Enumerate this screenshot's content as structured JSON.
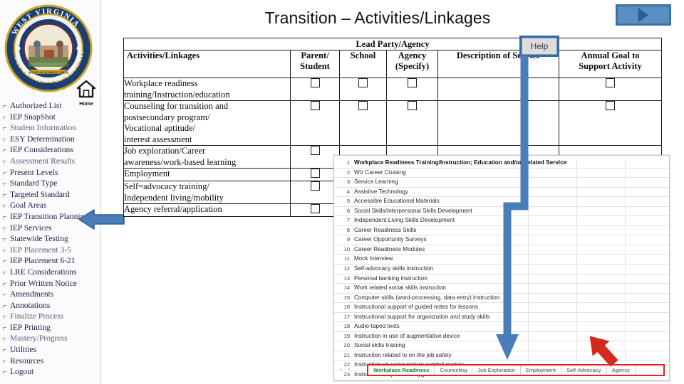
{
  "slide": {
    "title": "Transition – Activities/Linkages",
    "play_button_icon": "play-triangle-icon"
  },
  "sidebar": {
    "logo_alt": "West Virginia Department of Education",
    "seal_text": {
      "outer_top": "WEST VIRGINIA",
      "outer_bottom": "DEPARTMENT OF EDUCATION",
      "inner_top": "STATE OF WEST VIRGINIA",
      "inner_bottom": "MONTANI SEMPER LIBERI"
    },
    "home_label": "Home",
    "items": [
      {
        "label": "Authorized List"
      },
      {
        "label": "IEP SnapShot"
      },
      {
        "label": "Student Information"
      },
      {
        "label": "ESY Determination"
      },
      {
        "label": "IEP Considerations"
      },
      {
        "label": "Assessment Results"
      },
      {
        "label": "Present Levels"
      },
      {
        "label": "Standard Type"
      },
      {
        "label": "Targeted Standard"
      },
      {
        "label": "Goal Areas"
      },
      {
        "label": "IEP Transition Planning"
      },
      {
        "label": "IEP Services"
      },
      {
        "label": "Statewide Testing"
      },
      {
        "label": "IEP Placement 3-5"
      },
      {
        "label": "IEP Placement 6-21"
      },
      {
        "label": "LRE Considerations"
      },
      {
        "label": "Prior Written Notice"
      },
      {
        "label": "Amendments"
      },
      {
        "label": "Annotations"
      },
      {
        "label": "Finalize Process"
      },
      {
        "label": "IEP Printing"
      },
      {
        "label": "Mastery/Progress"
      },
      {
        "label": "Utilities"
      },
      {
        "label": "Resources"
      },
      {
        "label": "Logout"
      }
    ]
  },
  "form_table": {
    "group_header": "Lead Party/Agency",
    "columns": [
      "Activities/Linkages",
      "Parent/\nStudent",
      "School",
      "Agency\n(Specify)",
      "Description of Service",
      "Annual Goal to\nSupport Activity"
    ],
    "column_labels": {
      "activities": "Activities/Linkages",
      "parent_student_l1": "Parent/",
      "parent_student_l2": "Student",
      "school": "School",
      "agency_l1": "Agency",
      "agency_l2": "(Specify)",
      "description": "Description of Service",
      "goal_l1": "Annual Goal to",
      "goal_l2": "Support Activity"
    },
    "rows": [
      {
        "activity_lines": [
          "Workplace readiness",
          "training/Instruction/education"
        ],
        "parent_student": false,
        "school": false,
        "agency": false,
        "description": "",
        "annual_goal": false,
        "show_school": true,
        "show_agency": true,
        "show_goal": true
      },
      {
        "activity_lines": [
          "Counseling for transition and",
          "postsecondary program/",
          "Vocational aptitude/",
          "interest assessment"
        ],
        "parent_student": false,
        "school": false,
        "agency": false,
        "description": "",
        "annual_goal": false,
        "show_school": true,
        "show_agency": true,
        "show_goal": true
      },
      {
        "activity_lines": [
          "Job exploration/Career",
          "awareness/work-based learning"
        ],
        "parent_student": false,
        "school": false,
        "agency": false,
        "description": "",
        "annual_goal": false,
        "show_school": false,
        "show_agency": false,
        "show_goal": false
      },
      {
        "activity_lines": [
          "Employment"
        ],
        "parent_student": false,
        "school": false,
        "agency": false,
        "description": "",
        "annual_goal": false,
        "show_school": false,
        "show_agency": false,
        "show_goal": false
      },
      {
        "activity_lines": [
          "Self=advocacy training/",
          "Independent living/mobility"
        ],
        "parent_student": false,
        "school": false,
        "agency": false,
        "description": "",
        "annual_goal": false,
        "show_school": false,
        "show_agency": false,
        "show_goal": false
      },
      {
        "activity_lines": [
          "Agency referral/application"
        ],
        "parent_student": false,
        "school": false,
        "agency": false,
        "description": "",
        "annual_goal": false,
        "show_school": false,
        "show_agency": false,
        "show_goal": false
      }
    ],
    "help_button": "Help"
  },
  "spreadsheet": {
    "rows": [
      {
        "n": "1",
        "text": "Workplace Readiness Training/Instruction; Education and/or Related Service"
      },
      {
        "n": "2",
        "text": "WV Career Cruising"
      },
      {
        "n": "3",
        "text": "Service Learning"
      },
      {
        "n": "4",
        "text": "Assistive Technology"
      },
      {
        "n": "5",
        "text": "Accessible Educational Materials"
      },
      {
        "n": "6",
        "text": "Social Skills/Interpersonal Skills Development"
      },
      {
        "n": "7",
        "text": "Independent Living Skills Development"
      },
      {
        "n": "8",
        "text": "Career Readiness Skills"
      },
      {
        "n": "9",
        "text": "Career Opportunity Surveys"
      },
      {
        "n": "10",
        "text": "Career Readiness Modules"
      },
      {
        "n": "11",
        "text": "Mock Interview"
      },
      {
        "n": "12",
        "text": "Self-advocacy skills instruction"
      },
      {
        "n": "13",
        "text": "Personal banking instruction"
      },
      {
        "n": "14",
        "text": "Work related social skills instruction"
      },
      {
        "n": "15",
        "text": "Computer skills (word-processing, data entry) instruction"
      },
      {
        "n": "16",
        "text": "Instructional support of guided notes for lessons"
      },
      {
        "n": "17",
        "text": "Instructional support for organization and study skills"
      },
      {
        "n": "18",
        "text": "Audio-taped texts"
      },
      {
        "n": "19",
        "text": "Instruction in use of augmentative device"
      },
      {
        "n": "20",
        "text": "Social skills training"
      },
      {
        "n": "21",
        "text": "Instruction related to on the job safety"
      },
      {
        "n": "22",
        "text": "Instruction on using picture symbol recipes"
      },
      {
        "n": "23",
        "text": "Instruction on personal hygiene"
      }
    ],
    "tabs": [
      {
        "label": "Workplace Readiness",
        "active": true
      },
      {
        "label": "Counseling",
        "active": false
      },
      {
        "label": "Job Exploration",
        "active": false
      },
      {
        "label": "Employment",
        "active": false
      },
      {
        "label": "Self-Advocacy",
        "active": false
      },
      {
        "label": "Agency",
        "active": false
      }
    ],
    "nav_prev_icon": "chevron-left-icon",
    "nav_next_icon": "chevron-right-icon"
  },
  "annotations": {
    "blue_elbow_arrow": "blue-elbow-arrow-help-to-tabs",
    "red_arrow": "red-arrow-pointing-to-sheet-tabs",
    "sidebar_arrow": "blue-arrow-pointing-to-iep-transition-planning"
  },
  "colors": {
    "accent_blue": "#4a7ebb",
    "red_highlight": "#e8201e",
    "active_tab_green": "#1d7a35",
    "seal_blue": "#1b3f73",
    "seal_gold": "#c9a227"
  }
}
